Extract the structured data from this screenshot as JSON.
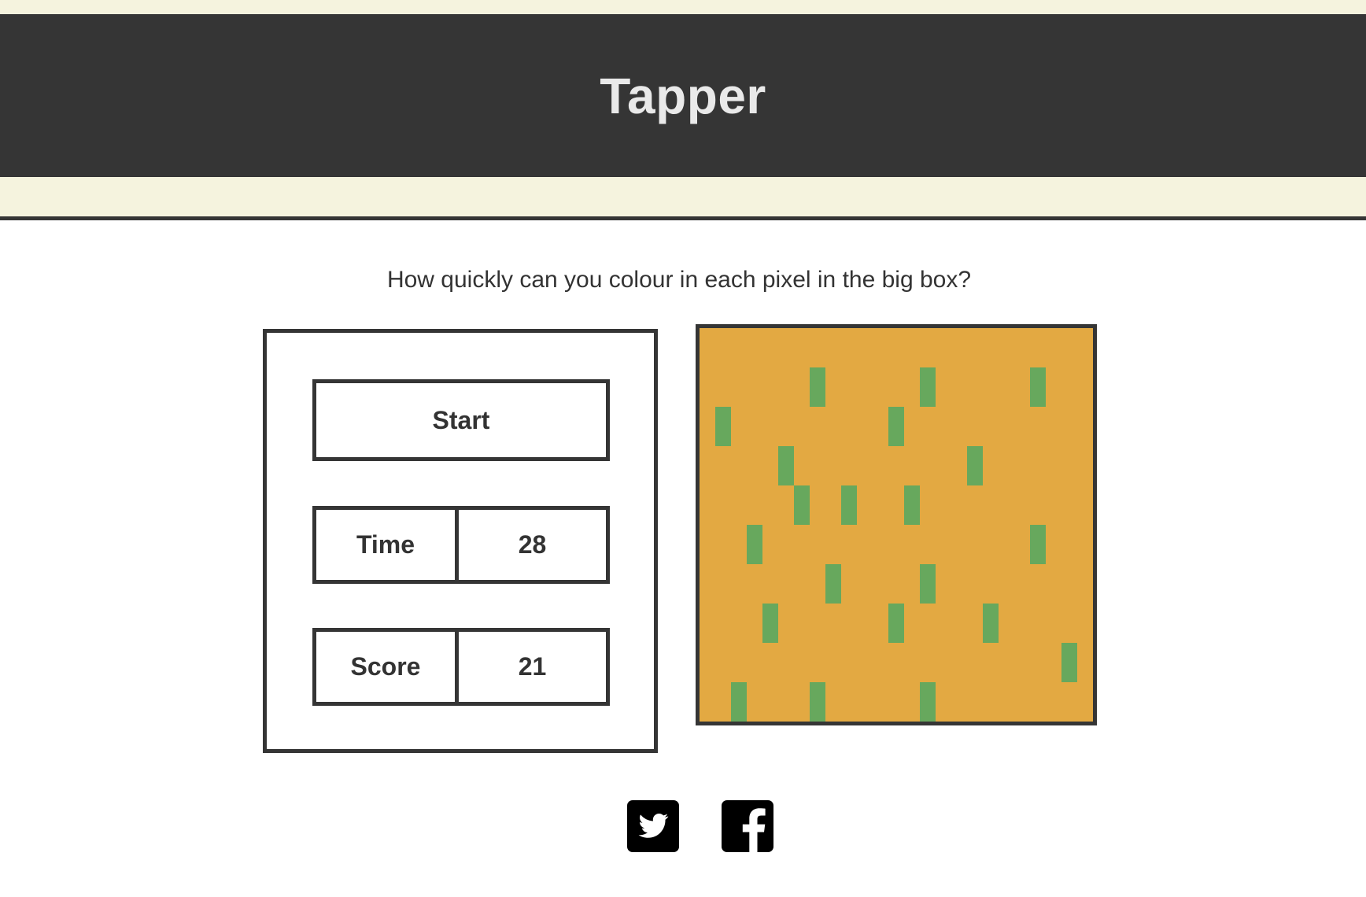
{
  "header": {
    "title": "Tapper"
  },
  "instructions": "How quickly can you colour in each pixel in the big box?",
  "controls": {
    "start_label": "Start",
    "time_label": "Time",
    "time_value": "28",
    "score_label": "Score",
    "score_value": "21"
  },
  "board": {
    "columns": 25,
    "rows": 10,
    "background": "#e3a942",
    "filled_color": "#67a85d",
    "filled_cells": [
      [
        7,
        1
      ],
      [
        14,
        1
      ],
      [
        21,
        1
      ],
      [
        1,
        2
      ],
      [
        12,
        2
      ],
      [
        5,
        3
      ],
      [
        17,
        3
      ],
      [
        6,
        4
      ],
      [
        9,
        4
      ],
      [
        13,
        4
      ],
      [
        3,
        5
      ],
      [
        21,
        5
      ],
      [
        8,
        6
      ],
      [
        14,
        6
      ],
      [
        4,
        7
      ],
      [
        12,
        7
      ],
      [
        18,
        7
      ],
      [
        23,
        8
      ],
      [
        2,
        9
      ],
      [
        7,
        9
      ],
      [
        14,
        9
      ]
    ]
  },
  "social": [
    {
      "name": "twitter",
      "icon": "twitter-icon"
    },
    {
      "name": "facebook",
      "icon": "facebook-icon"
    }
  ],
  "colors": {
    "header_bg": "#353535",
    "band_bg": "#f5f3de",
    "border": "#353535"
  }
}
